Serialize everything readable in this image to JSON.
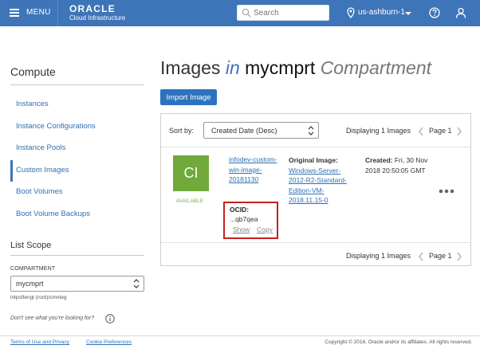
{
  "header": {
    "menu_label": "MENU",
    "logo_top": "ORACLE",
    "logo_bottom": "Cloud Infrastructure",
    "search_placeholder": "Search",
    "region": "us-ashburn-1"
  },
  "sidebar": {
    "title": "Compute",
    "items": [
      {
        "label": "Instances",
        "active": false
      },
      {
        "label": "Instance Configurations",
        "active": false
      },
      {
        "label": "Instance Pools",
        "active": false
      },
      {
        "label": "Custom Images",
        "active": true
      },
      {
        "label": "Boot Volumes",
        "active": false
      },
      {
        "label": "Boot Volume Backups",
        "active": false
      }
    ],
    "scope_title": "List Scope",
    "compartment_label": "COMPARTMENT",
    "compartment_value": "mycmprt",
    "compartment_path": "intpsftengt (root)/cmnteg",
    "cant_find": "Don't see what you're looking for?"
  },
  "main": {
    "title_word": "Images",
    "title_in": "in",
    "title_comp": "mycmprt",
    "title_suffix": "Compartment",
    "import_button": "Import Image",
    "sort_label": "Sort by:",
    "sort_value": "Created Date (Desc)",
    "displaying": "Displaying 1 Images",
    "page_label": "Page 1",
    "image": {
      "tile_text": "CI",
      "status": "AVAILABLE",
      "name": "infodev-custom-win-image-20181130",
      "ocid_label": "OCID:",
      "ocid_value": "...qb7qea",
      "show_label": "Show",
      "copy_label": "Copy",
      "original_label": "Original Image:",
      "original_value": "Windows-Server-2012-R2-Standard-Edition-VM-2018.11.15-0",
      "created_label": "Created:",
      "created_value": "Fri, 30 Nov 2018 20:50:05 GMT"
    }
  },
  "footer": {
    "terms": "Terms of Use and Privacy",
    "cookies": "Cookie Preferences",
    "copyright": "Copyright © 2018, Oracle and/or its affiliates. All rights reserved."
  },
  "colors": {
    "header_bg": "#3e75b8",
    "link": "#2c70b5",
    "available_green": "#71a93a",
    "highlight_red": "#c91f1f"
  }
}
